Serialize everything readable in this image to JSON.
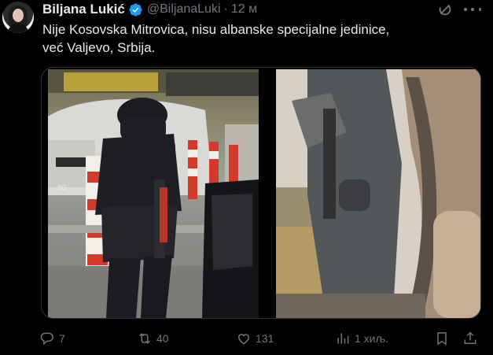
{
  "author": {
    "name": "Biljana Lukić",
    "handle": "@BiljanaLuki",
    "separator": "·",
    "time": "12 м"
  },
  "tweet": {
    "lines": [
      "Nije Kosovska Mitrovica, nisu albanske specijalne jedinice,",
      "već Valjevo, Srbija."
    ]
  },
  "media": {
    "left_plate": "BG"
  },
  "actions": {
    "replies": "7",
    "reposts": "40",
    "likes": "131",
    "views": "1 хиљ."
  },
  "colors": {
    "background": "#000000",
    "text": "#e7e9ea",
    "secondary": "#71767b",
    "verified": "#1d9bf0"
  }
}
